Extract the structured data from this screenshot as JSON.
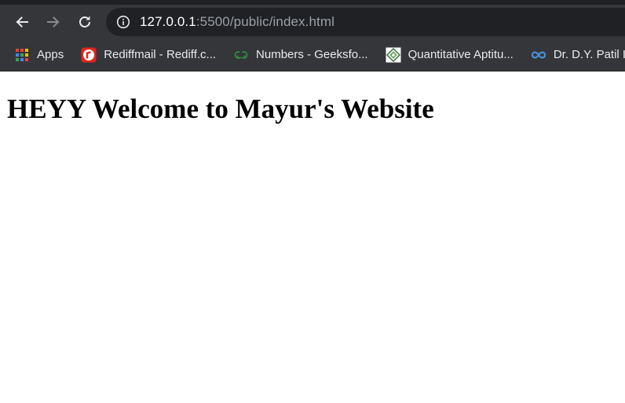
{
  "browser": {
    "address_bar": {
      "host": "127.0.0.1",
      "rest": ":5500/public/index.html"
    },
    "icons": {
      "back": "arrow-left-icon",
      "forward": "arrow-right-icon",
      "reload": "reload-icon",
      "site_info": "info-icon"
    },
    "bookmarks": [
      {
        "label": "Apps",
        "icon": "apps-grid-icon"
      },
      {
        "label": "Rediffmail - Rediff.c...",
        "icon": "rediff-logo-icon"
      },
      {
        "label": "Numbers - Geeksfo...",
        "icon": "geeksforgeeks-logo-icon"
      },
      {
        "label": "Quantitative Aptitu...",
        "icon": "indiabix-logo-icon"
      },
      {
        "label": "Dr. D.Y. Patil I",
        "icon": "coursera-infinity-icon"
      }
    ]
  },
  "page": {
    "heading": "HEYY Welcome to Mayur's Website"
  },
  "colors": {
    "chrome_bg": "#35363a",
    "omnibox_bg": "#202124",
    "url_muted": "#9aa0a6"
  }
}
